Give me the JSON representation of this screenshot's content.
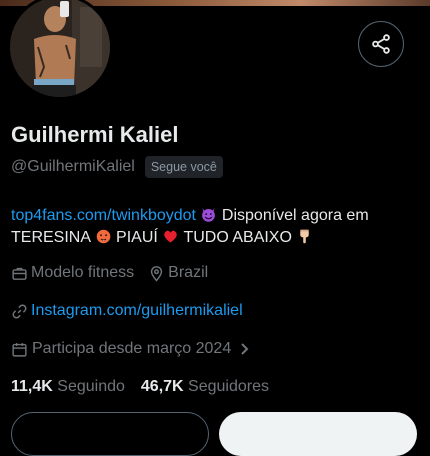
{
  "profile": {
    "name": "Guilhermi Kaliel",
    "handle": "@GuilhermiKaliel",
    "follows_you_badge": "Segue você"
  },
  "bio": {
    "link": "top4fans.com/twinkboydot",
    "text_1": "Disponível agora em TERESINA",
    "text_2": "PIAUÍ",
    "text_3": "TUDO ABAIXO",
    "emojis": [
      "smiling-devil-emoji",
      "hot-face-emoji",
      "red-heart-emoji",
      "pointing-down-emoji"
    ]
  },
  "meta": {
    "category": "Modelo fitness",
    "location": "Brazil",
    "website": "Instagram.com/guilhermikaliel",
    "joined": "Participa desde março 2024"
  },
  "stats": {
    "following_count": "11,4K",
    "following_label": "Seguindo",
    "followers_count": "46,7K",
    "followers_label": "Seguidores"
  },
  "icons": {
    "share": "share-icon",
    "category": "briefcase-icon",
    "location": "location-pin-icon",
    "website": "link-icon",
    "joined": "calendar-icon",
    "expand": "chevron-right-icon"
  },
  "colors": {
    "background": "#000000",
    "text_primary": "#e7e9ea",
    "text_secondary": "#71767b",
    "link": "#1d9bf0",
    "badge_bg": "#202327"
  }
}
